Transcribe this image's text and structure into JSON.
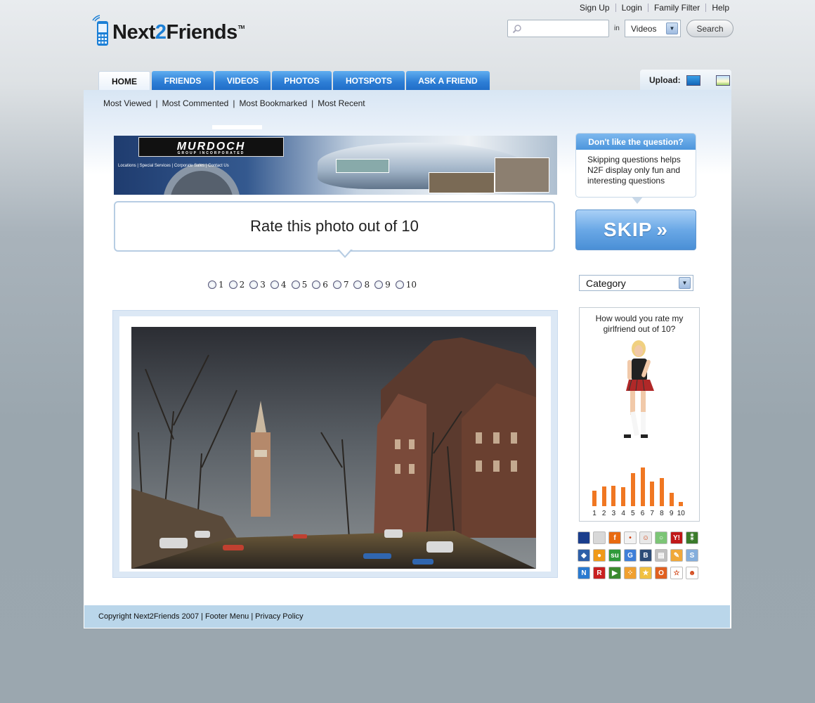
{
  "brand": {
    "name_part1": "Next",
    "name_part2": "2",
    "name_part3": "Friends",
    "tm": "TM",
    "accent": "#1b7fd6"
  },
  "top_links": [
    "Sign Up",
    "Login",
    "Family Filter",
    "Help"
  ],
  "search": {
    "placeholder": "",
    "in_label": "in",
    "scope_value": "Videos",
    "button_label": "Search"
  },
  "nav": {
    "tabs": [
      "HOME",
      "FRIENDS",
      "VIDEOS",
      "PHOTOS",
      "HOTSPOTS",
      "ASK A FRIEND"
    ],
    "active": "HOME"
  },
  "upload_label": "Upload:",
  "subnav": [
    "Most Viewed",
    "Most Commented",
    "Most Bookmarked",
    "Most Recent"
  ],
  "banner": {
    "logo_text": "MURDOCH",
    "logo_sub": "GROUP INCORPORATED",
    "links": "Locations | Special Services | Corporate Sales | Contact Us"
  },
  "question": {
    "text": "Rate this photo out of 10"
  },
  "rating_options": [
    "1",
    "2",
    "3",
    "4",
    "5",
    "6",
    "7",
    "8",
    "9",
    "10"
  ],
  "sidebar": {
    "dont_like_title": "Don't like the question?",
    "dont_like_body": "Skipping questions helps N2F display only fun and interesting questions",
    "skip_label": "SKIP",
    "category_label": "Category",
    "rate_card_question": "How would you rate my girlfriend out of 10?"
  },
  "chart_data": {
    "type": "bar",
    "categories": [
      "1",
      "2",
      "3",
      "4",
      "5",
      "6",
      "7",
      "8",
      "9",
      "10"
    ],
    "values": [
      22,
      28,
      29,
      27,
      47,
      55,
      35,
      40,
      19,
      6
    ],
    "color": "#f07722"
  },
  "social_icons": [
    "delicious-icon",
    "digg-icon",
    "furl-icon",
    "blinklist-icon",
    "reddit-icon",
    "spurl-icon",
    "yahoo-icon",
    "simpy-icon",
    "ma-gnolia-icon",
    "blogmarks-icon",
    "stumbleupon-icon",
    "google-icon",
    "bluedot-icon",
    "netscape-icon",
    "shadows-icon",
    "blinkbits-icon",
    "newsvine-icon",
    "rojo-icon",
    "diigo-icon",
    "feedmarker-icon",
    "rawsugar-icon",
    "oneview-icon",
    "fav-icon",
    "technorati-icon"
  ],
  "footer": {
    "copyright": "Copyright Next2Friends 2007",
    "menu": "Footer Menu",
    "privacy": "Privacy Policy",
    "sep": "|"
  }
}
